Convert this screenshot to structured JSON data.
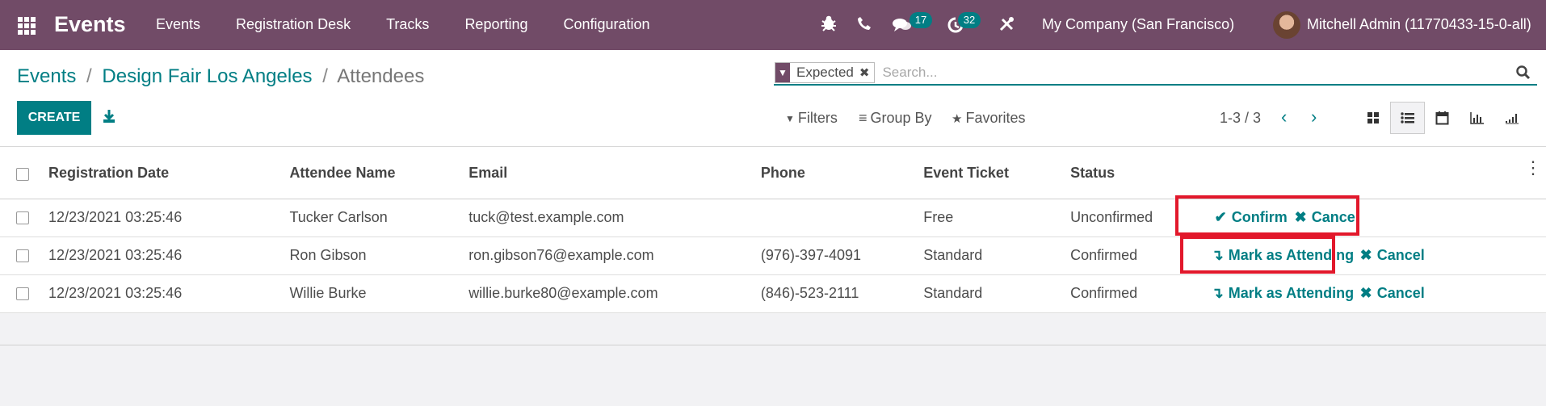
{
  "topbar": {
    "apps_icon": "apps-grid-icon",
    "brand": "Events",
    "menu": [
      "Events",
      "Registration Desk",
      "Tracks",
      "Reporting",
      "Configuration"
    ],
    "messages_badge": "17",
    "activities_badge": "32",
    "company": "My Company (San Francisco)",
    "user": "Mitchell Admin (11770433-15-0-all)"
  },
  "breadcrumb": {
    "events": "Events",
    "event": "Design Fair Los Angeles",
    "current": "Attendees",
    "separator": "/"
  },
  "toolbar": {
    "create_label": "CREATE",
    "download_icon": "download-icon",
    "filters_label": "Filters",
    "group_by_label": "Group By",
    "favorites_label": "Favorites",
    "pager": "1-3 / 3"
  },
  "search": {
    "facet": "Expected",
    "placeholder": "Search..."
  },
  "table": {
    "columns": [
      "Registration Date",
      "Attendee Name",
      "Email",
      "Phone",
      "Event Ticket",
      "Status"
    ],
    "rows": [
      {
        "date": "12/23/2021 03:25:46",
        "name": "Tucker Carlson",
        "email": "tuck@test.example.com",
        "phone": "",
        "ticket": "Free",
        "status": "Unconfirmed",
        "primary_action": "Confirm",
        "cancel_action": "Cancel"
      },
      {
        "date": "12/23/2021 03:25:46",
        "name": "Ron Gibson",
        "email": "ron.gibson76@example.com",
        "phone": "(976)-397-4091",
        "ticket": "Standard",
        "status": "Confirmed",
        "primary_action": "Mark as Attending",
        "cancel_action": "Cancel"
      },
      {
        "date": "12/23/2021 03:25:46",
        "name": "Willie Burke",
        "email": "willie.burke80@example.com",
        "phone": "(846)-523-2111",
        "ticket": "Standard",
        "status": "Confirmed",
        "primary_action": "Mark as Attending",
        "cancel_action": "Cancel"
      }
    ]
  },
  "colors": {
    "brand": "#714b67",
    "accent": "#017e84",
    "highlight": "#e2182b"
  }
}
